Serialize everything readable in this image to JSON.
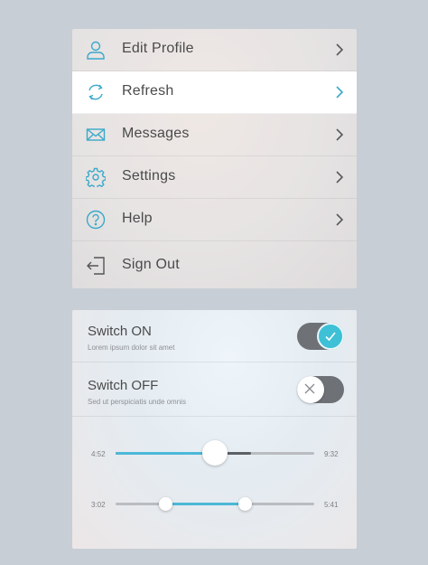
{
  "menu": {
    "items": [
      {
        "label": "Edit Profile",
        "icon": "user-icon"
      },
      {
        "label": "Refresh",
        "icon": "refresh-icon"
      },
      {
        "label": "Messages",
        "icon": "mail-icon"
      },
      {
        "label": "Settings",
        "icon": "gear-icon"
      },
      {
        "label": "Help",
        "icon": "help-icon"
      },
      {
        "label": "Sign Out",
        "icon": "sign-out-icon"
      }
    ],
    "active_item": "Refresh"
  },
  "switches": [
    {
      "title": "Switch ON",
      "subtitle": "Lorem ipsum dolor sit amet",
      "state": "on"
    },
    {
      "title": "Switch OFF",
      "subtitle": "Sed ut perspiciatis unde omnis",
      "state": "off"
    }
  ],
  "sliders": [
    {
      "min_label": "4:52",
      "max_label": "9:32",
      "value": 0.5,
      "buffered": 0.68
    },
    {
      "min_label": "3:02",
      "max_label": "5:41",
      "range_start": 0.25,
      "range_end": 0.65
    }
  ],
  "colors": {
    "accent": "#3ec0d6",
    "text": "#4a4a4a",
    "toggle_track": "#6e7277"
  }
}
